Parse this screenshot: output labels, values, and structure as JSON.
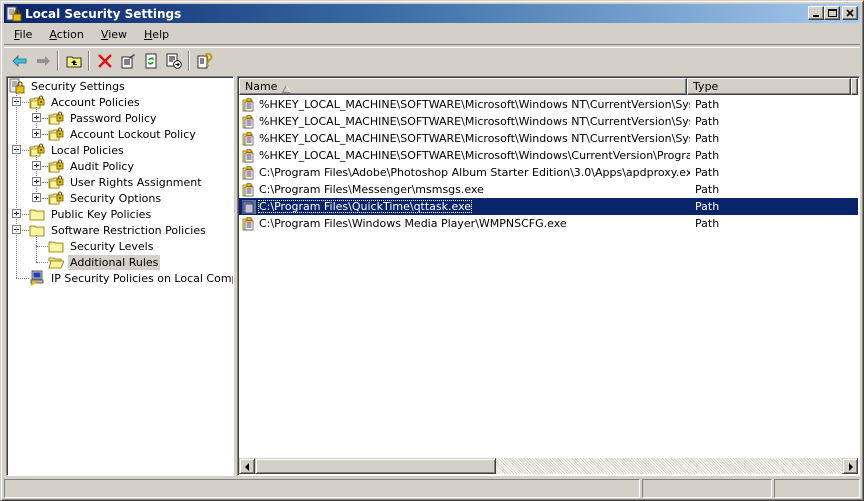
{
  "window": {
    "title": "Local Security Settings",
    "controls": {
      "minimize": "_",
      "maximize": "□",
      "close": "✕"
    }
  },
  "menubar": [
    {
      "label": "File",
      "accel": "F",
      "rest": "ile"
    },
    {
      "label": "Action",
      "accel": "A",
      "rest": "ction"
    },
    {
      "label": "View",
      "accel": "V",
      "rest": "iew"
    },
    {
      "label": "Help",
      "accel": "H",
      "rest": "elp"
    }
  ],
  "toolbar": {
    "buttons": [
      {
        "name": "back",
        "icon": "back-arrow-icon",
        "enabled": true
      },
      {
        "name": "forward",
        "icon": "forward-arrow-icon",
        "enabled": false
      },
      {
        "name": "up-one-level",
        "icon": "up-folder-icon",
        "enabled": true
      },
      {
        "name": "delete",
        "icon": "delete-icon",
        "enabled": true
      },
      {
        "name": "properties",
        "icon": "properties-icon",
        "enabled": true
      },
      {
        "name": "refresh",
        "icon": "refresh-icon",
        "enabled": true
      },
      {
        "name": "export-list",
        "icon": "export-list-icon",
        "enabled": true
      },
      {
        "name": "help",
        "icon": "help-icon",
        "enabled": true
      }
    ]
  },
  "tree": {
    "root": "Security Settings",
    "items": [
      {
        "label": "Account Policies",
        "level": 1,
        "expander": "minus",
        "icon": "policy-folder-icon"
      },
      {
        "label": "Password Policy",
        "level": 2,
        "expander": "plus",
        "icon": "policy-folder-icon"
      },
      {
        "label": "Account Lockout Policy",
        "level": 2,
        "expander": "plus",
        "icon": "policy-folder-icon"
      },
      {
        "label": "Local Policies",
        "level": 1,
        "expander": "minus",
        "icon": "policy-folder-icon"
      },
      {
        "label": "Audit Policy",
        "level": 2,
        "expander": "plus",
        "icon": "policy-folder-icon"
      },
      {
        "label": "User Rights Assignment",
        "level": 2,
        "expander": "plus",
        "icon": "policy-folder-icon"
      },
      {
        "label": "Security Options",
        "level": 2,
        "expander": "plus",
        "icon": "policy-folder-icon"
      },
      {
        "label": "Public Key Policies",
        "level": 1,
        "expander": "plus",
        "icon": "folder-icon"
      },
      {
        "label": "Software Restriction Policies",
        "level": 1,
        "expander": "minus",
        "icon": "folder-icon"
      },
      {
        "label": "Security Levels",
        "level": 2,
        "expander": "none",
        "icon": "folder-icon"
      },
      {
        "label": "Additional Rules",
        "level": 2,
        "expander": "none",
        "icon": "open-folder-icon",
        "selected": true
      },
      {
        "label": "IP Security Policies on Local Computer",
        "level": 1,
        "expander": "none",
        "icon": "ip-security-icon"
      }
    ]
  },
  "list": {
    "columns": {
      "name": "Name",
      "type": "Type",
      "sort": "ascending"
    },
    "rows": [
      {
        "name": "%HKEY_LOCAL_MACHINE\\SOFTWARE\\Microsoft\\Windows NT\\CurrentVersion\\System...",
        "type": "Path",
        "selected": false
      },
      {
        "name": "%HKEY_LOCAL_MACHINE\\SOFTWARE\\Microsoft\\Windows NT\\CurrentVersion\\System...",
        "type": "Path",
        "selected": false
      },
      {
        "name": "%HKEY_LOCAL_MACHINE\\SOFTWARE\\Microsoft\\Windows NT\\CurrentVersion\\System...",
        "type": "Path",
        "selected": false
      },
      {
        "name": "%HKEY_LOCAL_MACHINE\\SOFTWARE\\Microsoft\\Windows\\CurrentVersion\\ProgramFil...",
        "type": "Path",
        "selected": false
      },
      {
        "name": "C:\\Program Files\\Adobe\\Photoshop Album Starter Edition\\3.0\\Apps\\apdproxy.exe",
        "type": "Path",
        "selected": false
      },
      {
        "name": "C:\\Program Files\\Messenger\\msmsgs.exe",
        "type": "Path",
        "selected": false
      },
      {
        "name": "C:\\Program Files\\QuickTime\\qttask.exe",
        "type": "Path",
        "selected": true
      },
      {
        "name": "C:\\Program Files\\Windows Media Player\\WMPNSCFG.exe",
        "type": "Path",
        "selected": false
      }
    ],
    "scroll": {
      "horizontal_thumb_fraction": 0.41,
      "horizontal_position": 0
    }
  },
  "statusbar": {
    "panels": [
      "",
      "",
      ""
    ]
  },
  "colors": {
    "selection": "#0a246a",
    "titlebar_start": "#0a246a",
    "titlebar_end": "#a6caf0",
    "chrome": "#d4d0c8"
  }
}
